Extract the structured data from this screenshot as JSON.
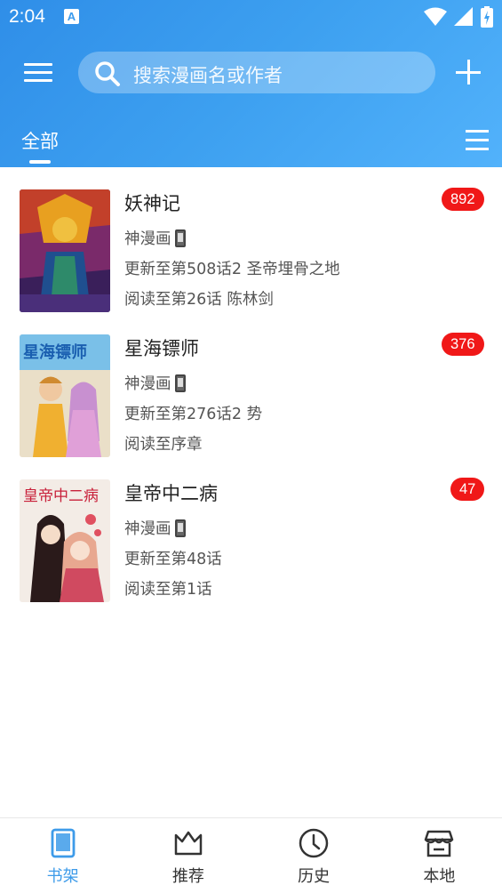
{
  "status_bar": {
    "time": "2:04",
    "notification_letter": "A"
  },
  "toolbar": {
    "search_placeholder": "搜索漫画名或作者"
  },
  "tabs": {
    "active_label": "全部"
  },
  "colors": {
    "accent": "#3d9be9",
    "badge": "#f01818",
    "header_start": "#2f8ee8",
    "header_end": "#52b2fb"
  },
  "comics": [
    {
      "title": "妖神记",
      "source": "神漫画",
      "update": "更新至第508话2 圣帝埋骨之地",
      "progress": "阅读至第26话 陈林剑",
      "badge": "892",
      "cover_text": ""
    },
    {
      "title": "星海镖师",
      "source": "神漫画",
      "update": "更新至第276话2 势",
      "progress": "阅读至序章",
      "badge": "376",
      "cover_text": "星海镖师"
    },
    {
      "title": "皇帝中二病",
      "source": "神漫画",
      "update": "更新至第48话",
      "progress": "阅读至第1话",
      "badge": "47",
      "cover_text": "皇帝中二病"
    }
  ],
  "bottom_nav": [
    {
      "label": "书架",
      "icon": "book-icon",
      "active": true
    },
    {
      "label": "推荐",
      "icon": "crown-icon",
      "active": false
    },
    {
      "label": "历史",
      "icon": "clock-icon",
      "active": false
    },
    {
      "label": "本地",
      "icon": "store-icon",
      "active": false
    }
  ]
}
